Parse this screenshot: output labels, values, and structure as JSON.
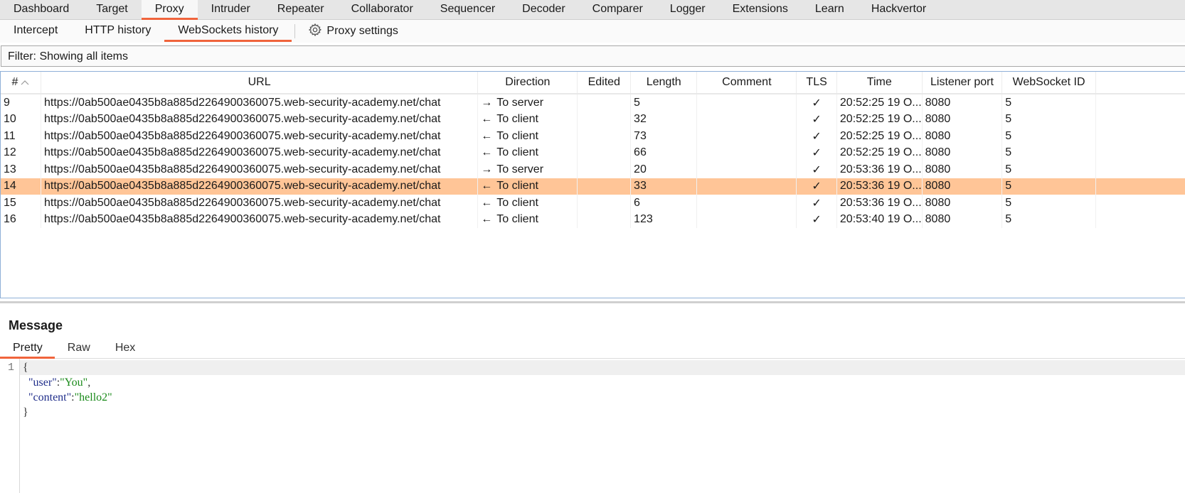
{
  "top_tabs": [
    {
      "label": "Dashboard",
      "active": false
    },
    {
      "label": "Target",
      "active": false
    },
    {
      "label": "Proxy",
      "active": true
    },
    {
      "label": "Intruder",
      "active": false
    },
    {
      "label": "Repeater",
      "active": false
    },
    {
      "label": "Collaborator",
      "active": false
    },
    {
      "label": "Sequencer",
      "active": false
    },
    {
      "label": "Decoder",
      "active": false
    },
    {
      "label": "Comparer",
      "active": false
    },
    {
      "label": "Logger",
      "active": false
    },
    {
      "label": "Extensions",
      "active": false
    },
    {
      "label": "Learn",
      "active": false
    },
    {
      "label": "Hackvertor",
      "active": false
    }
  ],
  "sub_tabs": [
    {
      "label": "Intercept",
      "active": false
    },
    {
      "label": "HTTP history",
      "active": false
    },
    {
      "label": "WebSockets history",
      "active": true
    }
  ],
  "proxy_settings": {
    "label": "Proxy settings",
    "icon": "gear-icon"
  },
  "filter": {
    "text": "Filter: Showing all items"
  },
  "table": {
    "columns": [
      "#",
      "URL",
      "Direction",
      "Edited",
      "Length",
      "Comment",
      "TLS",
      "Time",
      "Listener port",
      "WebSocket ID"
    ],
    "sort_indicator": "^",
    "rows": [
      {
        "num": "9",
        "url": "https://0ab500ae0435b8a885d2264900360075.web-security-academy.net/chat",
        "arrow": "→",
        "direction": "To server",
        "edited": "",
        "length": "5",
        "comment": "",
        "tls": "✓",
        "time": "20:52:25 19 O...",
        "port": "8080",
        "ws_id": "5",
        "selected": false
      },
      {
        "num": "10",
        "url": "https://0ab500ae0435b8a885d2264900360075.web-security-academy.net/chat",
        "arrow": "←",
        "direction": "To client",
        "edited": "",
        "length": "32",
        "comment": "",
        "tls": "✓",
        "time": "20:52:25 19 O...",
        "port": "8080",
        "ws_id": "5",
        "selected": false
      },
      {
        "num": "11",
        "url": "https://0ab500ae0435b8a885d2264900360075.web-security-academy.net/chat",
        "arrow": "←",
        "direction": "To client",
        "edited": "",
        "length": "73",
        "comment": "",
        "tls": "✓",
        "time": "20:52:25 19 O...",
        "port": "8080",
        "ws_id": "5",
        "selected": false
      },
      {
        "num": "12",
        "url": "https://0ab500ae0435b8a885d2264900360075.web-security-academy.net/chat",
        "arrow": "←",
        "direction": "To client",
        "edited": "",
        "length": "66",
        "comment": "",
        "tls": "✓",
        "time": "20:52:25 19 O...",
        "port": "8080",
        "ws_id": "5",
        "selected": false
      },
      {
        "num": "13",
        "url": "https://0ab500ae0435b8a885d2264900360075.web-security-academy.net/chat",
        "arrow": "→",
        "direction": "To server",
        "edited": "",
        "length": "20",
        "comment": "",
        "tls": "✓",
        "time": "20:53:36 19 O...",
        "port": "8080",
        "ws_id": "5",
        "selected": false
      },
      {
        "num": "14",
        "url": "https://0ab500ae0435b8a885d2264900360075.web-security-academy.net/chat",
        "arrow": "←",
        "direction": "To client",
        "edited": "",
        "length": "33",
        "comment": "",
        "tls": "✓",
        "time": "20:53:36 19 O...",
        "port": "8080",
        "ws_id": "5",
        "selected": true
      },
      {
        "num": "15",
        "url": "https://0ab500ae0435b8a885d2264900360075.web-security-academy.net/chat",
        "arrow": "←",
        "direction": "To client",
        "edited": "",
        "length": "6",
        "comment": "",
        "tls": "✓",
        "time": "20:53:36 19 O...",
        "port": "8080",
        "ws_id": "5",
        "selected": false
      },
      {
        "num": "16",
        "url": "https://0ab500ae0435b8a885d2264900360075.web-security-academy.net/chat",
        "arrow": "←",
        "direction": "To client",
        "edited": "",
        "length": "123",
        "comment": "",
        "tls": "✓",
        "time": "20:53:40 19 O...",
        "port": "8080",
        "ws_id": "5",
        "selected": false
      }
    ]
  },
  "message": {
    "title": "Message",
    "tabs": [
      {
        "label": "Pretty",
        "active": true
      },
      {
        "label": "Raw",
        "active": false
      },
      {
        "label": "Hex",
        "active": false
      }
    ],
    "line_number": "1",
    "code": {
      "open": "{",
      "user_key": "\"user\"",
      "user_val": "\"You\"",
      "content_key": "\"content\"",
      "content_val": "\"hello2\"",
      "close": "}"
    }
  },
  "colors": {
    "accent": "#f0643c",
    "selected_row": "#ffc597",
    "json_key": "#1f2d8a",
    "json_string": "#1a8a1a"
  }
}
